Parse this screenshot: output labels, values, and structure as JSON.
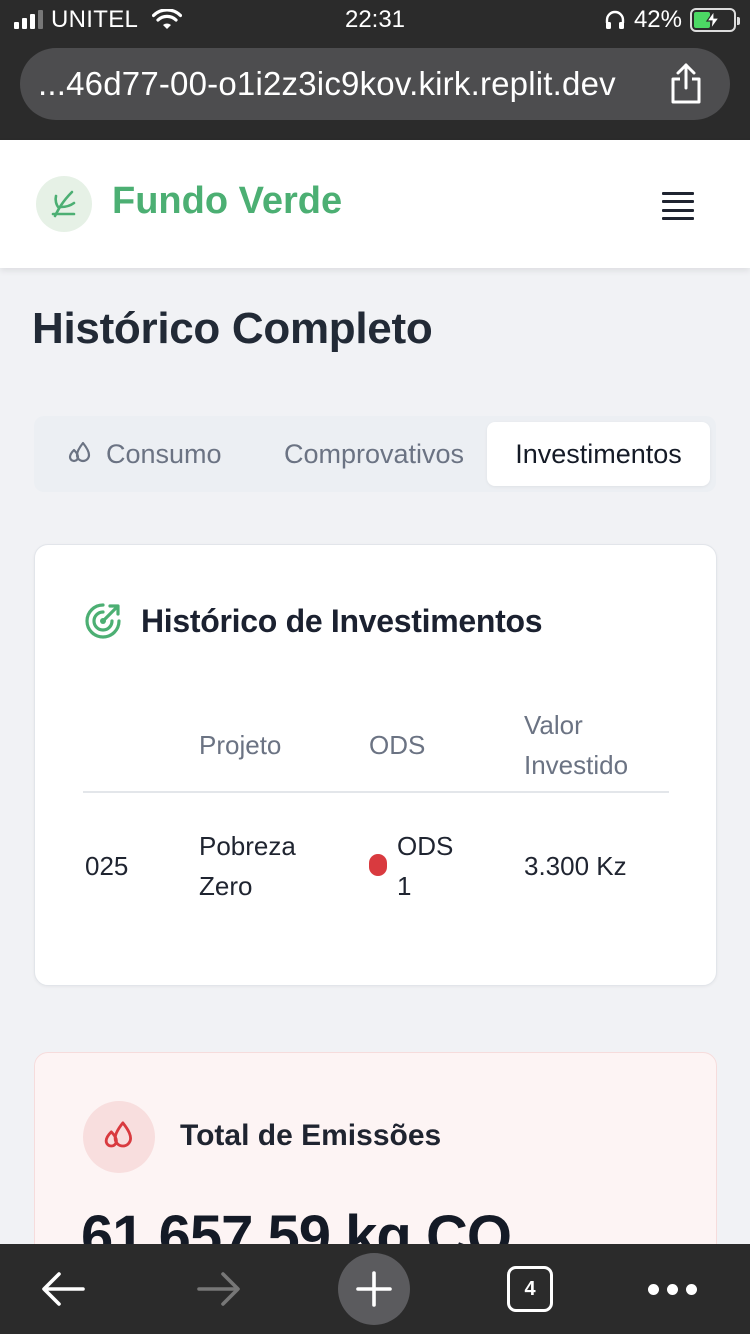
{
  "status_bar": {
    "carrier": "UNITEL",
    "time": "22:31",
    "battery_percent": "42%",
    "battery_level": 0.42,
    "icons": [
      "signal-icon",
      "wifi-icon",
      "headphones-icon",
      "battery-charging-icon"
    ]
  },
  "browser": {
    "url": "...46d77-00-o1i2z3ic9kov.kirk.replit.dev",
    "tab_count": "4",
    "icons": [
      "share-icon",
      "back-arrow-icon",
      "forward-arrow-icon",
      "plus-icon",
      "tabs-icon",
      "more-icon"
    ]
  },
  "header": {
    "brand": "Fundo Verde",
    "logo_icon": "sprout-icon",
    "menu_icon": "hamburger-menu-icon",
    "brand_color": "#4caf73"
  },
  "page": {
    "title": "Histórico Completo"
  },
  "tabs": [
    {
      "label": "Consumo",
      "icon": "droplets-icon",
      "active": false
    },
    {
      "label": "Comprovativos",
      "active": false
    },
    {
      "label": "Investimentos",
      "active": true
    }
  ],
  "investments": {
    "title": "Histórico de Investimentos",
    "icon": "target-growth-icon",
    "columns": [
      "",
      "Projeto",
      "ODS",
      "Valor Investido"
    ],
    "rows": [
      {
        "id": "025",
        "projeto": "Pobreza Zero",
        "ods": "ODS 1",
        "ods_color": "#d93a3f",
        "valor": "3.300 Kz"
      }
    ]
  },
  "emissions": {
    "title": "Total de Emissões",
    "icon": "droplets-icon",
    "value": "61.657,59 kg CO"
  }
}
